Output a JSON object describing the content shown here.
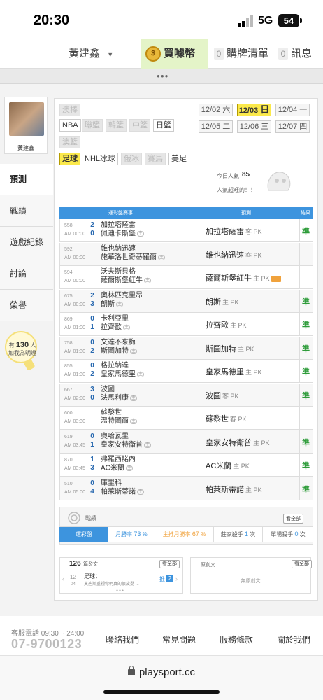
{
  "status_bar": {
    "time": "20:30",
    "network": "5G",
    "battery": "54"
  },
  "top_nav": {
    "user": "黃建鑫",
    "buy": "買噱幣",
    "lottery_count": "0",
    "lottery_label": "購牌清單",
    "message_count": "0",
    "message_label": "訊息"
  },
  "profile": {
    "name": "黃建鑫"
  },
  "side_menu": [
    "預測",
    "戰績",
    "遊戲紀錄",
    "討論",
    "榮譽"
  ],
  "followers": {
    "prefix": "有",
    "count": "130",
    "suffix": "人",
    "line2": "加我為明燈"
  },
  "sport_chips": {
    "row1": [
      "澳棒"
    ],
    "row2": [
      "NBA",
      "聯籃",
      "韓籃",
      "中籃",
      "日籃"
    ],
    "row3": [
      "澳籃"
    ],
    "row4": [
      "足球",
      "NHL冰球",
      "俄冰",
      "賽馬",
      "美足"
    ]
  },
  "dates": [
    {
      "date": "12/02",
      "day": "六"
    },
    {
      "date": "12/03",
      "day": "日"
    },
    {
      "date": "12/04",
      "day": "一"
    },
    {
      "date": "12/05",
      "day": "二"
    },
    {
      "date": "12/06",
      "day": "三"
    },
    {
      "date": "12/07",
      "day": "四"
    }
  ],
  "popularity": {
    "label": "今日人氣",
    "value": "85",
    "sub": "人氣超旺的！！"
  },
  "table": {
    "header_match": "運彩盤賽事",
    "header_pred": "預測",
    "header_result": "結果",
    "rows": [
      {
        "id": "558",
        "time": "AM 00:00",
        "s1": "2",
        "s2": "0",
        "t1": "加拉塔薩雷",
        "t2": "佩迪卡斯堡",
        "pred": "加拉塔薩雷",
        "side": "客 PK",
        "result": "準"
      },
      {
        "id": "592",
        "time": "AM 00:00",
        "s1": "",
        "s2": "",
        "t1": "維也納迅速",
        "t2": "施華洛世奇蒂羅爾",
        "pred": "維也納迅速",
        "side": "客 PK",
        "result": ""
      },
      {
        "id": "594",
        "time": "AM 00:00",
        "s1": "",
        "s2": "",
        "t1": "沃夫斯貝格",
        "t2": "薩爾斯堡紅牛",
        "pred": "薩爾斯堡紅牛",
        "side": "主 PK",
        "result": ""
      },
      {
        "id": "675",
        "time": "AM 00:00",
        "s1": "2",
        "s2": "3",
        "t1": "奧林匹克里昂",
        "t2": "朗斯",
        "pred": "朗斯",
        "side": "主 PK",
        "result": "準"
      },
      {
        "id": "869",
        "time": "AM 01:00",
        "s1": "0",
        "s2": "1",
        "t1": "卡利亞里",
        "t2": "拉齊歐",
        "pred": "拉齊歐",
        "side": "主 PK",
        "result": "準"
      },
      {
        "id": "758",
        "time": "AM 01:30",
        "s1": "0",
        "s2": "2",
        "t1": "文達不來梅",
        "t2": "斯圖加特",
        "pred": "斯圖加特",
        "side": "主 PK",
        "result": "準"
      },
      {
        "id": "855",
        "time": "AM 01:30",
        "s1": "0",
        "s2": "2",
        "t1": "格拉納達",
        "t2": "皇家馬德里",
        "pred": "皇家馬德里",
        "side": "主 PK",
        "result": "準"
      },
      {
        "id": "667",
        "time": "AM 02:00",
        "s1": "3",
        "s2": "0",
        "t1": "波圖",
        "t2": "法馬利康",
        "pred": "波圖",
        "side": "客 PK",
        "result": "準"
      },
      {
        "id": "600",
        "time": "AM 03:30",
        "s1": "",
        "s2": "",
        "t1": "蘇黎世",
        "t2": "溫特圖爾",
        "pred": "蘇黎世",
        "side": "客 PK",
        "result": ""
      },
      {
        "id": "619",
        "time": "AM 03:45",
        "s1": "0",
        "s2": "1",
        "t1": "奧哈瓦里",
        "t2": "皇家安特衛普",
        "pred": "皇家安特衛普",
        "side": "主 PK",
        "result": "準"
      },
      {
        "id": "870",
        "time": "AM 03:45",
        "s1": "1",
        "s2": "3",
        "t1": "弗羅西諾內",
        "t2": "AC米蘭",
        "pred": "AC米蘭",
        "side": "主 PK",
        "result": "準"
      },
      {
        "id": "510",
        "time": "AM 05:00",
        "s1": "0",
        "s2": "4",
        "t1": "庫里科",
        "t2": "帕萊斯蒂諾",
        "pred": "帕萊斯蒂諾",
        "side": "主 PK",
        "result": "準"
      }
    ],
    "home_badge": "主"
  },
  "record": {
    "title": "戰績",
    "all": "看全部",
    "tab": "運彩盤",
    "month_label": "月勝率",
    "month_value": "73",
    "month_unit": "%",
    "home_label": "主推月勝率",
    "home_value": "67",
    "home_unit": "%",
    "banker_label": "莊家殺手",
    "banker_value": "1",
    "banker_unit": "次",
    "single_label": "單場殺手",
    "single_value": "0",
    "single_unit": "次"
  },
  "posts": {
    "count": "126",
    "label": "篇發文",
    "all": "看全部",
    "date_m": "12",
    "date_d": "04",
    "title": "足球：",
    "excerpt": "莫迪斯重視你們真的很皮挺 ...",
    "push": "推",
    "push_count": "2"
  },
  "original": {
    "label": "原創文",
    "all": "看全部",
    "empty": "無原創文"
  },
  "footer": {
    "phone_label": "客服電話 09:30 ~ 24:00",
    "phone": "07-9700123",
    "links": [
      "聯絡我們",
      "常見問題",
      "服務條款",
      "關於我們"
    ]
  },
  "browser": {
    "url": "playsport.cc"
  },
  "colors": {
    "accent": "#3d94de",
    "highlight": "#fbe94b",
    "win": "#2e9c3a",
    "buy_bg": "#e4f4c8"
  }
}
